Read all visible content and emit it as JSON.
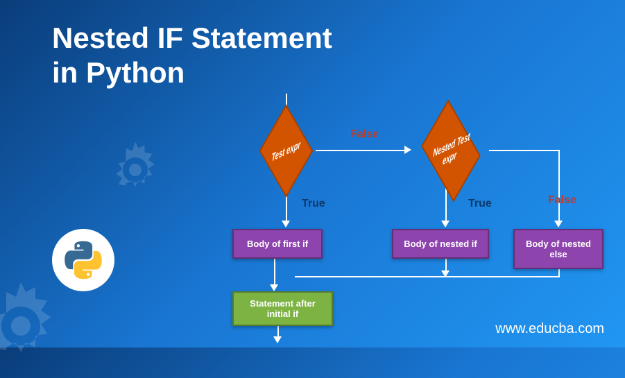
{
  "title_line1": "Nested IF Statement",
  "title_line2": "in Python",
  "url": "www.educba.com",
  "flowchart": {
    "test_expr": "Test expr",
    "nested_test_expr": "Nested Test  expr",
    "body_first_if": "Body of first if",
    "body_nested_if": "Body of nested if",
    "body_nested_else": "Body of nested else",
    "statement_after": "Statement after initial if",
    "label_true": "True",
    "label_false": "False"
  }
}
